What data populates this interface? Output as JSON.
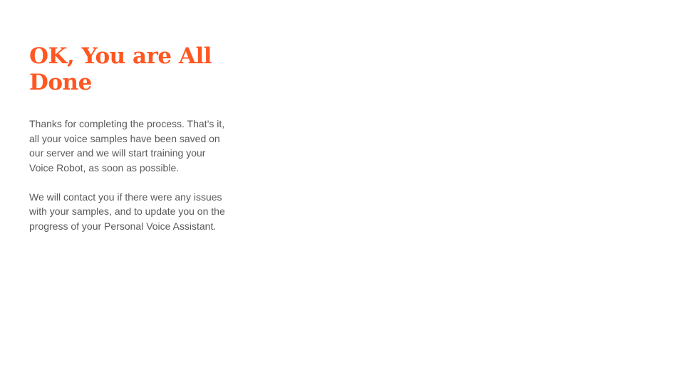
{
  "slide": {
    "title": "OK, You are All Done",
    "paragraphs": [
      "Thanks for completing the process. That’s it, all your voice samples have been saved on our server and we will start training your Voice Robot, as soon as possible.",
      "We will contact you if there were any issues with your samples, and to update you on the progress of your Personal Voice Assistant."
    ]
  },
  "colors": {
    "accent": "#ff5722",
    "text": "#595959",
    "background": "#ffffff"
  }
}
